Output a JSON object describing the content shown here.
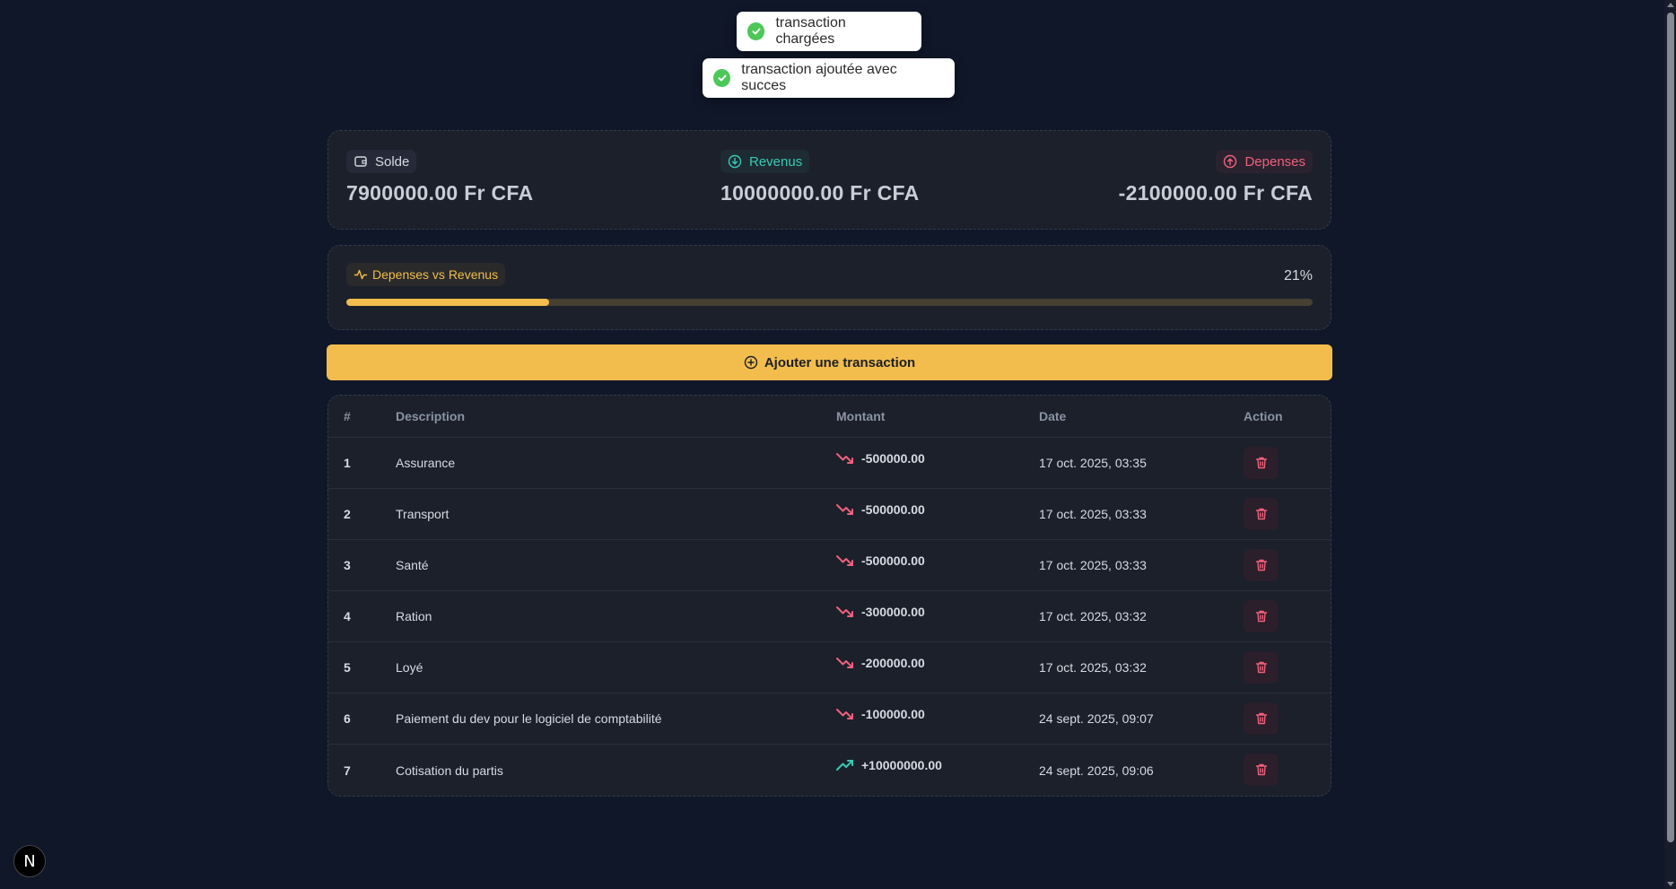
{
  "toasts": [
    {
      "text": "transaction chargées"
    },
    {
      "text": "transaction ajoutée avec succes"
    }
  ],
  "stats": {
    "solde": {
      "label": "Solde",
      "amount": "7900000.00 Fr CFA",
      "icon": "wallet-icon"
    },
    "revenus": {
      "label": "Revenus",
      "amount": "10000000.00 Fr CFA",
      "icon": "arrow-down-circle-icon",
      "color": "#38c9b5"
    },
    "depenses": {
      "label": "Depenses",
      "amount": "-2100000.00 Fr CFA",
      "icon": "arrow-up-circle-icon",
      "color": "#f0617a"
    }
  },
  "progress": {
    "label": "Depenses vs Revenus",
    "percent_label": "21%",
    "fraction": 0.21,
    "color": "#f2bd4c"
  },
  "add_button": {
    "label": "Ajouter une transaction"
  },
  "table": {
    "headers": {
      "num": "#",
      "description": "Description",
      "amount": "Montant",
      "date": "Date",
      "action": "Action"
    },
    "rows": [
      {
        "num": "1",
        "description": "Assurance",
        "amount": "-500000.00",
        "type": "down",
        "date": "17 oct. 2025, 03:35"
      },
      {
        "num": "2",
        "description": "Transport",
        "amount": "-500000.00",
        "type": "down",
        "date": "17 oct. 2025, 03:33"
      },
      {
        "num": "3",
        "description": "Santé",
        "amount": "-500000.00",
        "type": "down",
        "date": "17 oct. 2025, 03:33"
      },
      {
        "num": "4",
        "description": "Ration",
        "amount": "-300000.00",
        "type": "down",
        "date": "17 oct. 2025, 03:32"
      },
      {
        "num": "5",
        "description": "Loyé",
        "amount": "-200000.00",
        "type": "down",
        "date": "17 oct. 2025, 03:32"
      },
      {
        "num": "6",
        "description": "Paiement du dev pour le logiciel de comptabilité",
        "amount": "-100000.00",
        "type": "down",
        "date": "24 sept. 2025, 09:07"
      },
      {
        "num": "7",
        "description": "Cotisation du partis",
        "amount": "+10000000.00",
        "type": "up",
        "date": "24 sept. 2025, 09:06"
      }
    ]
  },
  "colors": {
    "down": "#f0617a",
    "up": "#38c9b5",
    "accent": "#f2bd4c"
  },
  "badge": {
    "text": "N"
  }
}
